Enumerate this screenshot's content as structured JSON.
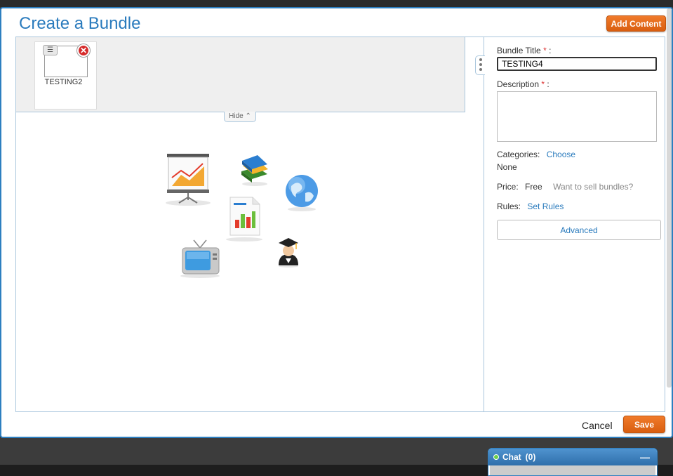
{
  "modal": {
    "title": "Create a Bundle",
    "add_content_label": "Add Content",
    "cancel_label": "Cancel",
    "save_label": "Save"
  },
  "tray": {
    "items": [
      {
        "label": "TESTING2",
        "menu_icon": "hamburger-icon",
        "close_icon": "close-icon"
      }
    ],
    "hide_label": "Hide ⌃"
  },
  "illustration": {
    "icons": [
      "presentation-chart-icon",
      "books-icon",
      "globe-icon",
      "document-chart-icon",
      "television-icon",
      "graduate-icon"
    ]
  },
  "form": {
    "title_label": "Bundle Title",
    "title_value": "TESTING4",
    "description_label": "Description",
    "required_marker": "*",
    "label_suffix": ":",
    "categories_label": "Categories:",
    "categories_link": "Choose",
    "categories_value": "None",
    "price_label": "Price:",
    "price_value": "Free",
    "price_hint": "Want to sell bundles?",
    "rules_label": "Rules:",
    "rules_link": "Set Rules",
    "advanced_label": "Advanced"
  },
  "chat": {
    "label": "Chat",
    "count": "(0)",
    "minimize": "—"
  },
  "colors": {
    "accent": "#2a7bbd",
    "action": "#e86a1c",
    "required": "#dd3333"
  }
}
